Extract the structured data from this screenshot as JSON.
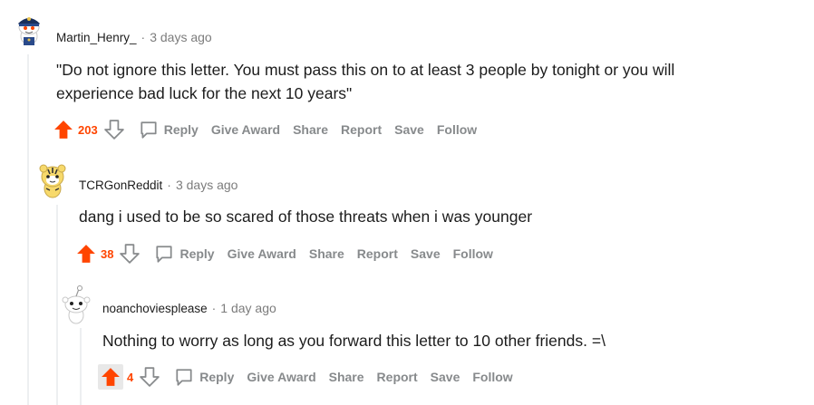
{
  "accent_color": "#ff4500",
  "muted_color": "#878a8c",
  "comments": [
    {
      "author": "Martin_Henry_",
      "separator": "·",
      "time": "3 days ago",
      "body_lines": [
        "\"Do not ignore this letter. You must pass this on to at least 3 people by tonight or you will",
        "experience bad luck for the next 10 years\""
      ],
      "score": "203",
      "actions": {
        "reply": "Reply",
        "give_award": "Give Award",
        "share": "Share",
        "report": "Report",
        "save": "Save",
        "follow": "Follow"
      },
      "upvoted": true,
      "avatar_icon": "snoo-police-avatar-icon"
    },
    {
      "author": "TCRGonReddit",
      "separator": "·",
      "time": "3 days ago",
      "body_lines": [
        "dang i used to be so scared of those threats when i was younger"
      ],
      "score": "38",
      "actions": {
        "reply": "Reply",
        "give_award": "Give Award",
        "share": "Share",
        "report": "Report",
        "save": "Save",
        "follow": "Follow"
      },
      "upvoted": true,
      "avatar_icon": "snoo-tiger-avatar-icon"
    },
    {
      "author": "noanchoviesplease",
      "separator": "·",
      "time": "1 day ago",
      "body_lines": [
        "Nothing to worry as long as you forward this letter to 10 other friends. =\\"
      ],
      "score": "4",
      "actions": {
        "reply": "Reply",
        "give_award": "Give Award",
        "share": "Share",
        "report": "Report",
        "save": "Save",
        "follow": "Follow"
      },
      "upvoted": true,
      "avatar_icon": "snoo-default-avatar-icon"
    }
  ]
}
